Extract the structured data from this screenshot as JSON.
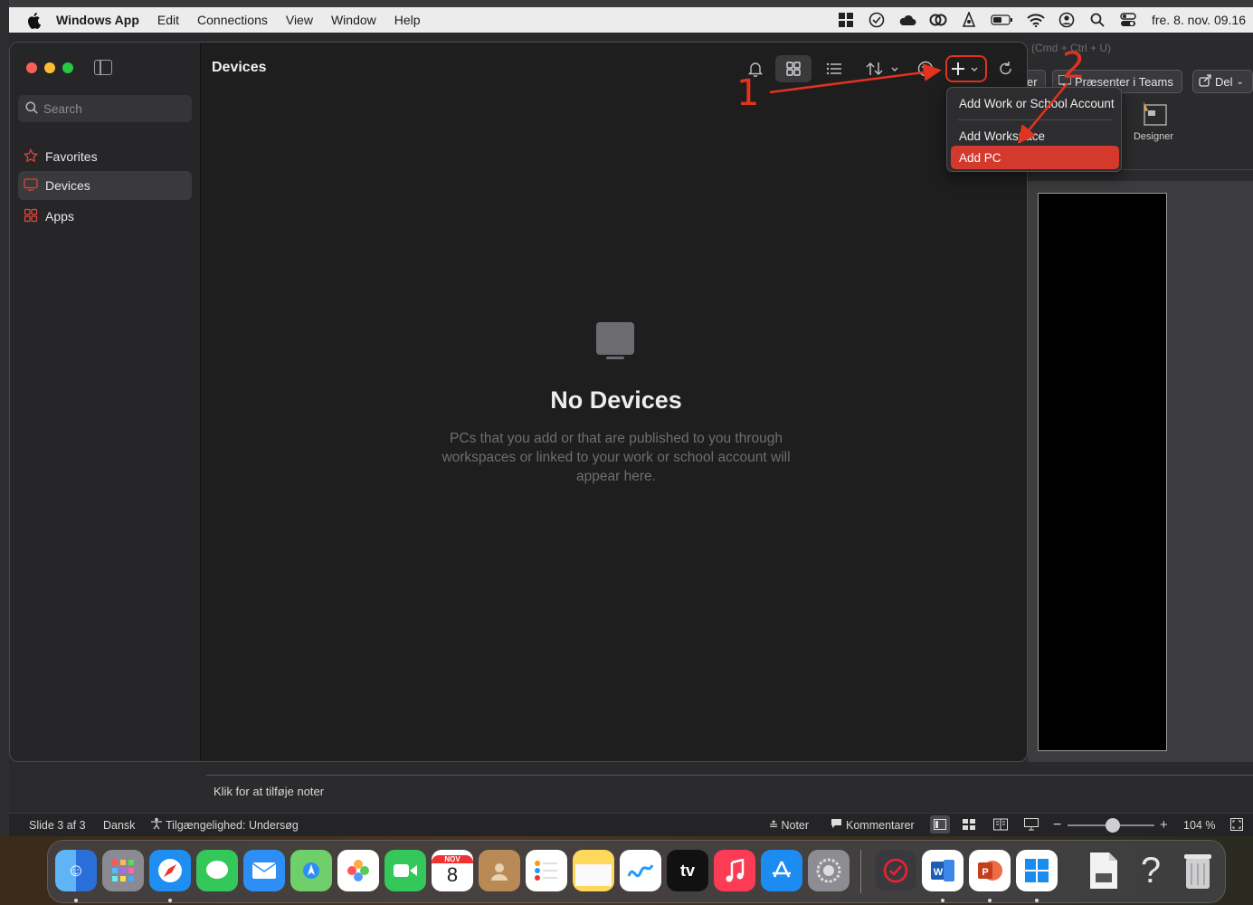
{
  "menubar": {
    "apple_icon": "apple-logo",
    "items": [
      "Windows App",
      "Edit",
      "Connections",
      "View",
      "Window",
      "Help"
    ],
    "status_icons": [
      "windows-app-icon",
      "checkmark-circle-icon",
      "cloud-icon",
      "creative-cloud-icon",
      "vector-icon",
      "battery-icon",
      "wifi-icon",
      "user-circle-icon",
      "search-icon",
      "control-center-icon"
    ],
    "clock": "fre. 8. nov.  09.16"
  },
  "powerpoint": {
    "shortcut_hint": "(Cmd + Ctrl + U)",
    "partial_button": "er",
    "present_teams": "Præsenter i Teams",
    "share": "Del",
    "designer": "Designer",
    "notes_placeholder": "Klik for at tilføje noter",
    "status": {
      "slide": "Slide 3 af 3",
      "language": "Dansk",
      "accessibility": "Tilgængelighed: Undersøg",
      "notes": "Noter",
      "comments": "Kommentarer",
      "zoom": "104 %",
      "zoom_fraction": 0.52
    }
  },
  "app": {
    "search_placeholder": "Search",
    "nav": [
      {
        "label": "Favorites",
        "icon": "star-icon"
      },
      {
        "label": "Devices",
        "icon": "monitor-icon",
        "active": true
      },
      {
        "label": "Apps",
        "icon": "apps-grid-icon"
      }
    ],
    "title": "Devices",
    "toolbar_icons": [
      "bell-icon",
      "grid-view-icon",
      "list-view-icon",
      "sort-icon",
      "filter-icon",
      "add-icon",
      "refresh-icon"
    ],
    "empty_title": "No Devices",
    "empty_desc": "PCs that you add or that are published to you through workspaces or linked to your work or school account will appear here."
  },
  "dropdown": {
    "items": [
      "Add Work or School Account",
      "Add Workspace",
      "Add PC"
    ],
    "highlighted": "Add PC"
  },
  "annotations": {
    "step1": "1",
    "step2": "2",
    "color": "#e3321f"
  },
  "dock": {
    "apps": [
      "finder",
      "launchpad",
      "safari",
      "messages",
      "mail",
      "maps",
      "photos",
      "facetime",
      "calendar",
      "contacts",
      "reminders",
      "notes",
      "freeform",
      "apple-tv",
      "music",
      "app-store",
      "system-settings",
      "todo",
      "word",
      "powerpoint",
      "windows-app",
      "file",
      "help",
      "trash"
    ],
    "calendar_month": "NOV",
    "calendar_day": "8",
    "tv_label": "tv"
  }
}
